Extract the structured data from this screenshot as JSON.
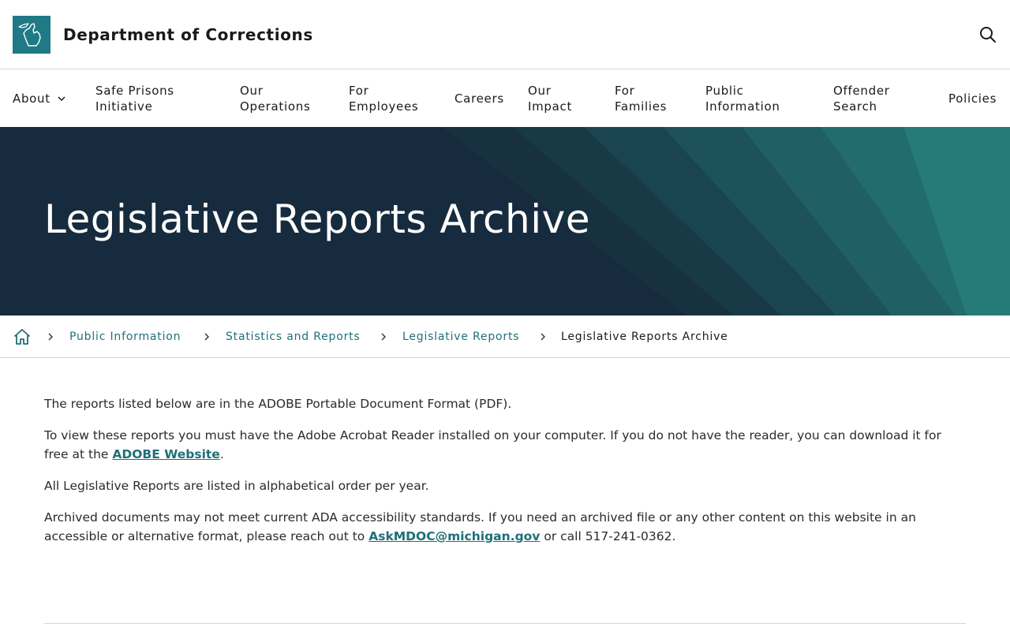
{
  "header": {
    "title": "Department of Corrections",
    "logo_icon": "michigan-state-icon",
    "search_icon": "search-icon"
  },
  "nav": {
    "items": [
      {
        "label": "About",
        "has_dropdown": true
      },
      {
        "label": "Safe Prisons Initiative",
        "line1": "Safe Prisons",
        "line2": "Initiative"
      },
      {
        "label": "Our Operations",
        "line1": "Our",
        "line2": "Operations"
      },
      {
        "label": "For Employees",
        "line1": "For",
        "line2": "Employees"
      },
      {
        "label": "Careers"
      },
      {
        "label": "Our Impact",
        "line1": "Our",
        "line2": "Impact"
      },
      {
        "label": "For Families",
        "line1": "For",
        "line2": "Families"
      },
      {
        "label": "Public Information",
        "line1": "Public",
        "line2": "Information"
      },
      {
        "label": "Offender Search",
        "line1": "Offender",
        "line2": "Search"
      },
      {
        "label": "Policies"
      }
    ]
  },
  "hero": {
    "title": "Legislative Reports Archive"
  },
  "breadcrumb": {
    "home_icon": "home-icon",
    "items": [
      {
        "label": "Public Information"
      },
      {
        "label": "Statistics and Reports"
      },
      {
        "label": "Legislative Reports"
      },
      {
        "label": "Legislative Reports Archive"
      }
    ]
  },
  "content": {
    "p1": "The reports listed below are in the ADOBE Portable Document Format (PDF).",
    "p2_before": "To view these reports you must have the Adobe Acrobat Reader installed on your computer. If you do not have the reader, you can download it for free at the ",
    "p2_link": "ADOBE Website",
    "p2_after": ".",
    "p3": "All Legislative Reports are listed in alphabetical order per year.",
    "p4_before": "Archived documents may not meet current ADA accessibility standards. If you need an archived file or any other content on this website in an accessible or alternative format, please reach out to ",
    "p4_link": "AskMDOC@michigan.gov",
    "p4_after": " or call 517-241-0362."
  },
  "colors": {
    "brand_teal": "#1f7a85",
    "link": "#1f6f78",
    "hero_dark": "#162b3d"
  }
}
